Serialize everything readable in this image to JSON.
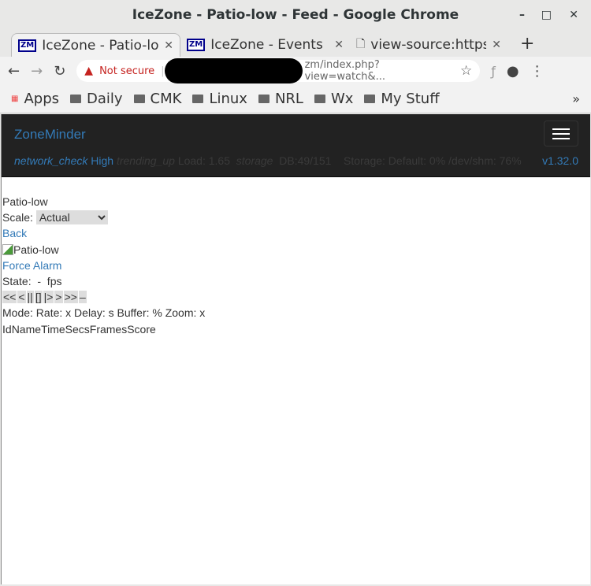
{
  "window": {
    "title": "IceZone - Patio-low - Feed - Google Chrome",
    "min": "–",
    "max": "□",
    "close": "✕"
  },
  "tabs": [
    {
      "label": "IceZone - Patio-low",
      "icon": "ZM"
    },
    {
      "label": "IceZone - Events",
      "icon": "ZM"
    },
    {
      "label": "view-source:https",
      "icon": "🗋"
    }
  ],
  "new_tab": "+",
  "toolbar": {
    "back": "←",
    "forward": "→",
    "reload": "↻",
    "security": "Not secure",
    "url": "zm/index.php?view=watch&...",
    "star": "☆",
    "menu": "⋮"
  },
  "bookmarks": [
    "Apps",
    "Daily",
    "CMK",
    "Linux",
    "NRL",
    "Wx",
    "My Stuff"
  ],
  "bookmarks_more": "»",
  "nav": {
    "brand": "ZoneMinder",
    "network_icon": "network_check",
    "network": "High",
    "load_icon": "trending_up",
    "load": "Load: 1.65",
    "db_icon": "storage",
    "db": "DB:49/151",
    "storage": "Storage: Default: 0% /dev/shm: 76%",
    "version": "v1.32.0"
  },
  "main": {
    "monitor": "Patio-low",
    "scale_label": "Scale:",
    "scale_value": "Actual",
    "back": "Back",
    "image_alt": "Patio-low",
    "force_alarm": "Force Alarm",
    "state": "State:  -  fps",
    "controls": [
      "<<",
      "<",
      "||",
      "[]",
      "|>",
      ">",
      ">>",
      "–"
    ],
    "mode": "Mode: Rate: x Delay: s Buffer: % Zoom: x",
    "columns": [
      "Id",
      "Name",
      "Time",
      "Secs",
      "Frames",
      "Score"
    ]
  }
}
